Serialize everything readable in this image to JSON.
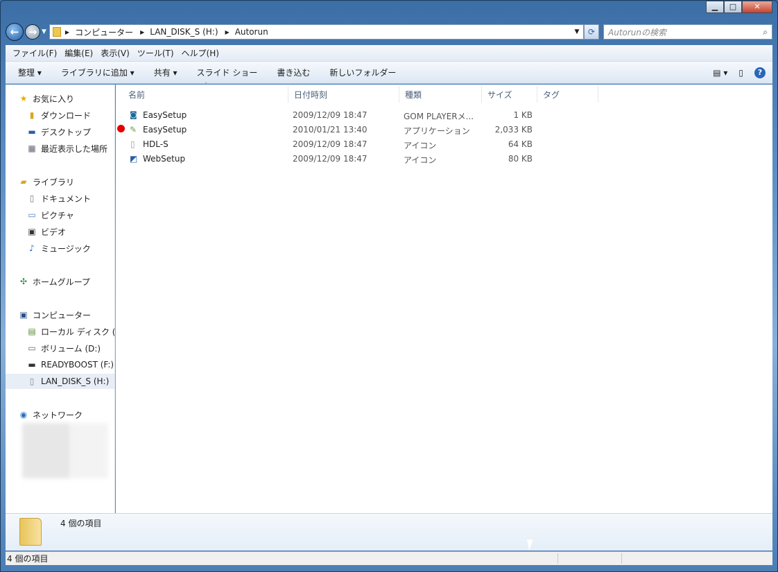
{
  "window": {
    "minimize": "▁",
    "maximize": "□",
    "close": "✕"
  },
  "address": {
    "crumbs": [
      "コンピューター",
      "LAN_DISK_S (H:)",
      "Autorun"
    ],
    "search_placeholder": "Autorunの検索"
  },
  "menu": [
    "ファイル(F)",
    "編集(E)",
    "表示(V)",
    "ツール(T)",
    "ヘルプ(H)"
  ],
  "toolbar": {
    "items": [
      "整理 ▾",
      "ライブラリに追加 ▾",
      "共有 ▾",
      "スライド ショー",
      "書き込む",
      "新しいフォルダー"
    ],
    "views": "▤ ▾",
    "preview": "▯",
    "help": "?"
  },
  "sidebar": {
    "favorites": {
      "label": "お気に入り",
      "items": [
        "ダウンロード",
        "デスクトップ",
        "最近表示した場所"
      ]
    },
    "libraries": {
      "label": "ライブラリ",
      "items": [
        "ドキュメント",
        "ピクチャ",
        "ビデオ",
        "ミュージック"
      ]
    },
    "homegroup": "ホームグループ",
    "computer": {
      "label": "コンピューター",
      "items": [
        "ローカル ディスク (",
        "ボリューム (D:)",
        "READYBOOST (F:)",
        "LAN_DISK_S (H:)"
      ]
    },
    "network": "ネットワーク"
  },
  "columns": [
    "名前",
    "日付時刻",
    "種類",
    "サイズ",
    "タグ"
  ],
  "files": [
    {
      "name": "EasySetup",
      "date": "2009/12/09 18:47",
      "type": "GOM PLAYERメ...",
      "size": "1 KB",
      "icon": "dat-file-icon"
    },
    {
      "name": "EasySetup",
      "date": "2010/01/21 13:40",
      "type": "アプリケーション",
      "size": "2,033 KB",
      "icon": "application-icon"
    },
    {
      "name": "HDL-S",
      "date": "2009/12/09 18:47",
      "type": "アイコン",
      "size": "64 KB",
      "icon": "drive-icon"
    },
    {
      "name": "WebSetup",
      "date": "2009/12/09 18:47",
      "type": "アイコン",
      "size": "80 KB",
      "icon": "websetup-icon"
    }
  ],
  "details": {
    "count": "4 個の項目"
  },
  "status": {
    "text": "4 個の項目"
  }
}
